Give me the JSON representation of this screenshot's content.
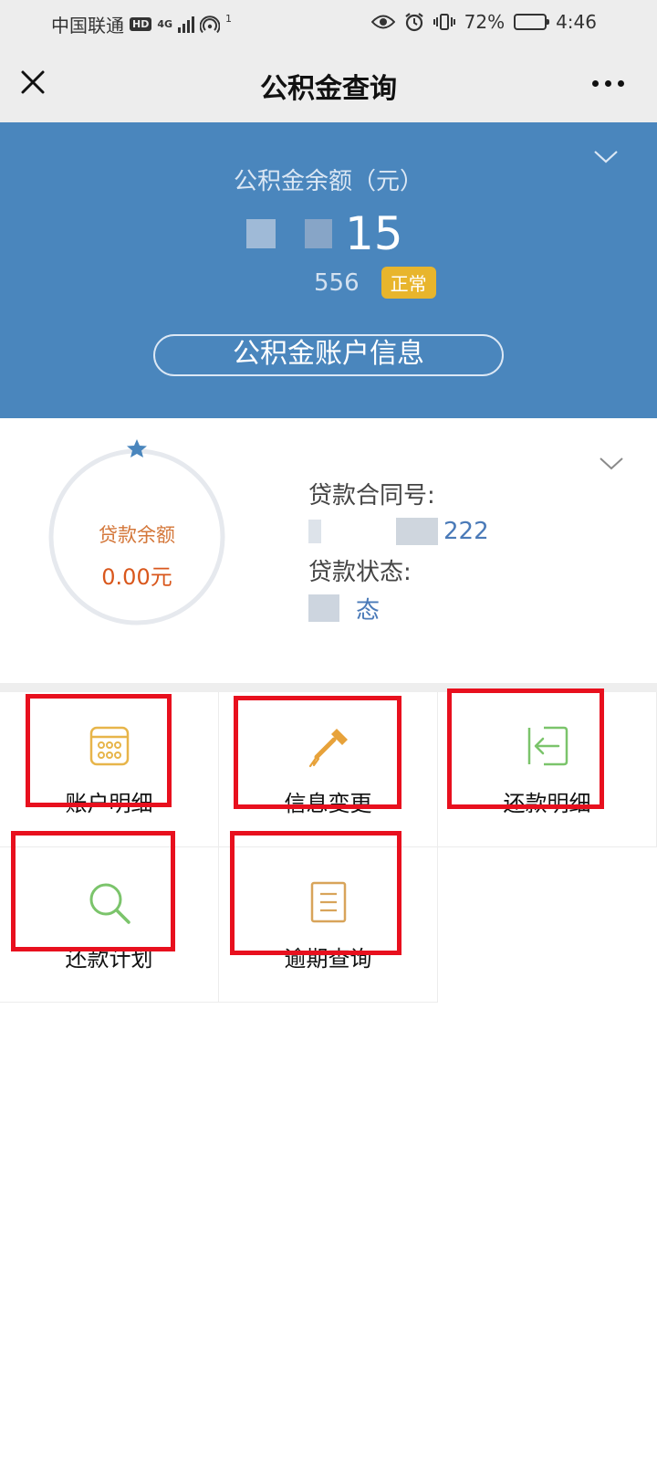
{
  "status_bar": {
    "carrier": "中国联通",
    "hd": "HD",
    "network": "4G",
    "hotspot_badge": "1",
    "battery": "72%",
    "battery_level": 0.72,
    "time": "4:46"
  },
  "nav": {
    "title": "公积金查询"
  },
  "fund": {
    "balance_label": "公积金余额（元）",
    "balance_visible": "15",
    "account_visible": "556",
    "status": "正常",
    "account_info_button": "公积金账户信息"
  },
  "loan": {
    "balance_label": "贷款余额",
    "balance_value": "0.00元",
    "contract_label": "贷款合同号:",
    "contract_visible": "222",
    "status_label": "贷款状态:",
    "status_visible": "态"
  },
  "grid": {
    "items": [
      {
        "label": "账户明细",
        "icon": "calendar-grid-icon",
        "color": "#e7b54a"
      },
      {
        "label": "信息变更",
        "icon": "screwdriver-icon",
        "color": "#e7a23a"
      },
      {
        "label": "还款明细",
        "icon": "sign-in-arrow-icon",
        "color": "#7bc46b"
      },
      {
        "label": "还款计划",
        "icon": "search-icon",
        "color": "#7bc46b"
      },
      {
        "label": "逾期查询",
        "icon": "document-icon",
        "color": "#d8a45a"
      }
    ]
  },
  "colors": {
    "fund_panel": "#4a86bd",
    "status_badge": "#e8b52c",
    "highlight_box": "#e8101e"
  }
}
